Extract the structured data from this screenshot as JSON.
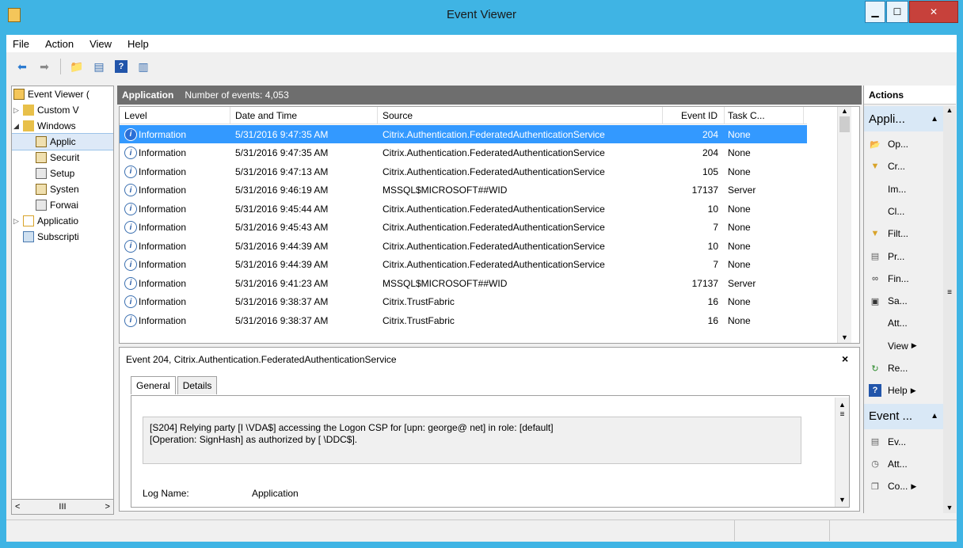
{
  "window": {
    "title": "Event Viewer"
  },
  "menu": [
    "File",
    "Action",
    "View",
    "Help"
  ],
  "tree": [
    {
      "label": "Event Viewer (",
      "indent": 0
    },
    {
      "label": "Custom V",
      "indent": 1
    },
    {
      "label": "Windows",
      "indent": 1
    },
    {
      "label": "Applic",
      "indent": 2,
      "selected": true
    },
    {
      "label": "Securit",
      "indent": 2
    },
    {
      "label": "Setup",
      "indent": 2
    },
    {
      "label": "Systen",
      "indent": 2
    },
    {
      "label": "Forwai",
      "indent": 2
    },
    {
      "label": "Applicatio",
      "indent": 1
    },
    {
      "label": "Subscripti",
      "indent": 1
    }
  ],
  "center": {
    "log_name": "Application",
    "count_text": "Number of events: 4,053"
  },
  "columns": {
    "level": "Level",
    "date": "Date and Time",
    "source": "Source",
    "event_id": "Event ID",
    "task": "Task C..."
  },
  "events": [
    {
      "level": "Information",
      "date": "5/31/2016 9:47:35 AM",
      "source": "Citrix.Authentication.FederatedAuthenticationService",
      "id": "204",
      "task": "None",
      "selected": true
    },
    {
      "level": "Information",
      "date": "5/31/2016 9:47:35 AM",
      "source": "Citrix.Authentication.FederatedAuthenticationService",
      "id": "204",
      "task": "None"
    },
    {
      "level": "Information",
      "date": "5/31/2016 9:47:13 AM",
      "source": "Citrix.Authentication.FederatedAuthenticationService",
      "id": "105",
      "task": "None"
    },
    {
      "level": "Information",
      "date": "5/31/2016 9:46:19 AM",
      "source": "MSSQL$MICROSOFT##WID",
      "id": "17137",
      "task": "Server"
    },
    {
      "level": "Information",
      "date": "5/31/2016 9:45:44 AM",
      "source": "Citrix.Authentication.FederatedAuthenticationService",
      "id": "10",
      "task": "None"
    },
    {
      "level": "Information",
      "date": "5/31/2016 9:45:43 AM",
      "source": "Citrix.Authentication.FederatedAuthenticationService",
      "id": "7",
      "task": "None"
    },
    {
      "level": "Information",
      "date": "5/31/2016 9:44:39 AM",
      "source": "Citrix.Authentication.FederatedAuthenticationService",
      "id": "10",
      "task": "None"
    },
    {
      "level": "Information",
      "date": "5/31/2016 9:44:39 AM",
      "source": "Citrix.Authentication.FederatedAuthenticationService",
      "id": "7",
      "task": "None"
    },
    {
      "level": "Information",
      "date": "5/31/2016 9:41:23 AM",
      "source": "MSSQL$MICROSOFT##WID",
      "id": "17137",
      "task": "Server"
    },
    {
      "level": "Information",
      "date": "5/31/2016 9:38:37 AM",
      "source": "Citrix.TrustFabric",
      "id": "16",
      "task": "None"
    },
    {
      "level": "Information",
      "date": "5/31/2016 9:38:37 AM",
      "source": "Citrix.TrustFabric",
      "id": "16",
      "task": "None"
    }
  ],
  "detail": {
    "title": "Event 204, Citrix.Authentication.FederatedAuthenticationService",
    "close": "×",
    "tabs": [
      "General",
      "Details"
    ],
    "message_line1": "[S204] Relying party [I               \\VDA$] accessing the Logon CSP for [upn: george@               net] in role: [default]",
    "message_line2": "[Operation: SignHash] as authorized by [                    \\DDC$].",
    "log_name_label": "Log Name:",
    "log_name_value": "Application"
  },
  "actions": {
    "title": "Actions",
    "section1": "Appli...",
    "section1_items": [
      {
        "label": "Op...",
        "icon": "folder-open-icon"
      },
      {
        "label": "Cr...",
        "icon": "filter-icon"
      },
      {
        "label": "Im...",
        "icon": ""
      },
      {
        "label": "Cl...",
        "icon": ""
      },
      {
        "label": "Filt...",
        "icon": "filter-icon"
      },
      {
        "label": "Pr...",
        "icon": "properties-icon"
      },
      {
        "label": "Fin...",
        "icon": "binoculars-icon"
      },
      {
        "label": "Sa...",
        "icon": "save-icon"
      },
      {
        "label": "Att...",
        "icon": ""
      },
      {
        "label": "View",
        "icon": "",
        "arrow": true
      },
      {
        "label": "Re...",
        "icon": "refresh-icon"
      },
      {
        "label": "Help",
        "icon": "help-icon",
        "arrow": true
      }
    ],
    "section2": "Event ...",
    "section2_items": [
      {
        "label": "Ev...",
        "icon": "properties-icon"
      },
      {
        "label": "Att...",
        "icon": "clock-icon"
      },
      {
        "label": "Co...",
        "icon": "copy-icon",
        "arrow": true
      }
    ]
  }
}
